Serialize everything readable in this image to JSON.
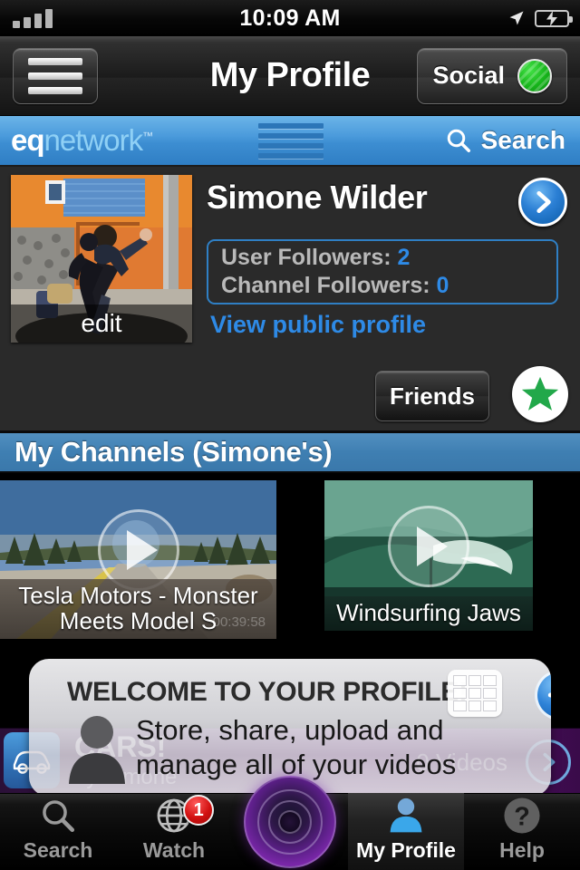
{
  "status_bar": {
    "time": "10:09 AM",
    "signal_icon": "signal-bars-icon",
    "location_icon": "location-arrow-icon",
    "battery_icon": "battery-charging-icon",
    "signal_bars": 4
  },
  "nav_bar": {
    "title": "My Profile",
    "menu_icon": "hamburger-menu-icon",
    "social_label": "Social",
    "social_status_icon": "green-status-dot-icon",
    "social_status_color": "#16b51a"
  },
  "brand_bar": {
    "logo_primary": "eq",
    "logo_secondary": "network",
    "logo_tm": "™",
    "grid_icon": "stacked-lines-icon",
    "search_label": "Search",
    "search_icon": "search-icon"
  },
  "profile": {
    "avatar_edit_label": "edit",
    "avatar_icon": "profile-photo-dancers",
    "name": "Simone Wilder",
    "disclosure_icon": "chevron-right-icon",
    "stats": [
      {
        "label": "User Followers:",
        "value": "2"
      },
      {
        "label": "Channel Followers:",
        "value": "0"
      }
    ],
    "public_profile_link": "View public profile",
    "friends_button": "Friends",
    "star_icon": "green-star-icon",
    "star_color": "#22a84a",
    "link_color": "#2e8ae6"
  },
  "channels_section": {
    "header": "My Channels (Simone's)",
    "videos": [
      {
        "title": "Tesla Motors - Monster Meets Model S",
        "duration": "00:39:58",
        "play_icon": "play-button-icon",
        "thumb": "road-through-forest"
      },
      {
        "title": "Windsurfing Jaws",
        "duration": "",
        "play_icon": "play-button-icon",
        "thumb": "green-ocean-wave"
      }
    ]
  },
  "channel_row": {
    "icon": "car-icon",
    "title": "CARS!",
    "subtitle": "by Simone",
    "video_count": "0 Videos",
    "chevron_icon": "chevron-right-circle-icon"
  },
  "welcome_overlay": {
    "title": "WELCOME TO YOUR PROFILE!",
    "body": "Store, share, upload and manage all of your videos",
    "grid_icon": "grid-view-icon",
    "plus_icon": "add-plus-icon",
    "person_icon": "person-silhouette-icon"
  },
  "tab_bar": {
    "tabs": [
      {
        "label": "Search",
        "icon": "search-icon",
        "active": false,
        "badge": ""
      },
      {
        "label": "Watch",
        "icon": "globe-icon",
        "active": false,
        "badge": "1"
      },
      {
        "label": "",
        "icon": "record-button-icon",
        "active": false,
        "badge": ""
      },
      {
        "label": "My Profile",
        "icon": "person-icon",
        "active": true,
        "badge": ""
      },
      {
        "label": "Help",
        "icon": "question-mark-icon",
        "active": false,
        "badge": ""
      }
    ]
  }
}
